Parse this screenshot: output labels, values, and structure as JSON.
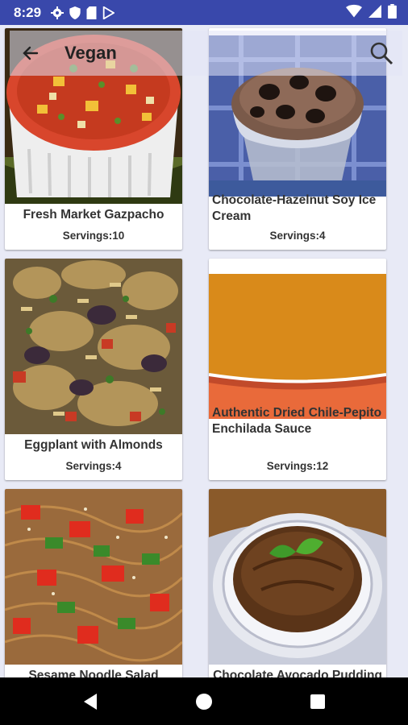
{
  "status_bar": {
    "time": "8:29",
    "left_icons": [
      "gear-icon",
      "shield-icon",
      "sd-card-icon",
      "play-store-icon"
    ],
    "right_icons": [
      "wifi-icon",
      "cellular-signal-icon",
      "battery-icon"
    ]
  },
  "toolbar": {
    "title": "Vegan",
    "back_icon": "arrow-left-icon",
    "search_icon": "search-icon"
  },
  "recipes": [
    {
      "name": "Fresh Market Gazpacho",
      "servings": "Servings:10",
      "photo": "gazpacho"
    },
    {
      "name": "Chocolate-Hazelnut Soy Ice Cream",
      "servings": "Servings:4",
      "photo": "ice-cream"
    },
    {
      "name": "Eggplant with Almonds",
      "servings": "Servings:4",
      "photo": "eggplant"
    },
    {
      "name": "Authentic Dried Chile-Pepito Enchilada Sauce",
      "servings": "Servings:12",
      "photo": "enchilada-sauce"
    },
    {
      "name": "Sesame Noodle Salad",
      "servings": "",
      "photo": "noodle-salad"
    },
    {
      "name": "Chocolate Avocado Pudding",
      "servings": "",
      "photo": "pudding"
    }
  ],
  "nav_bar": {
    "back": "back-triangle-icon",
    "home": "home-circle-icon",
    "recents": "recents-square-icon"
  },
  "colors": {
    "status_bar": "#3948ab",
    "background": "#e8eaf6"
  }
}
